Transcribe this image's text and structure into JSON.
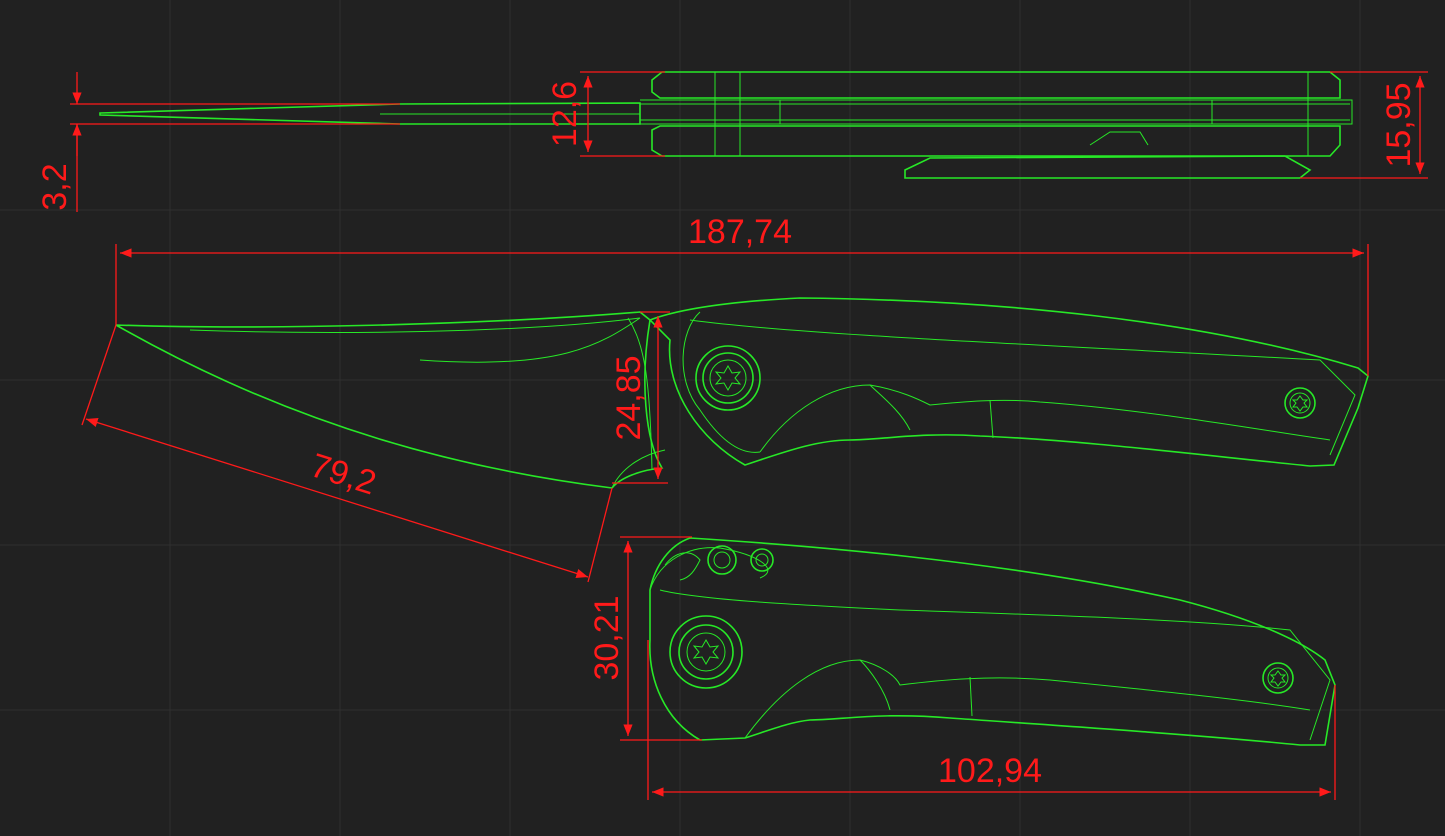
{
  "colors": {
    "background": "#212121",
    "grid": "#2f2f2f",
    "geometry": "#27e827",
    "dimension": "#ff1a1a"
  },
  "dimensions": {
    "overall_length": "187,74",
    "blade_length": "79,2",
    "blade_height": "24,85",
    "closed_length": "102,94",
    "closed_height": "30,21",
    "blade_thickness": "3,2",
    "handle_thickness": "12,6",
    "total_thickness": "15,95"
  }
}
